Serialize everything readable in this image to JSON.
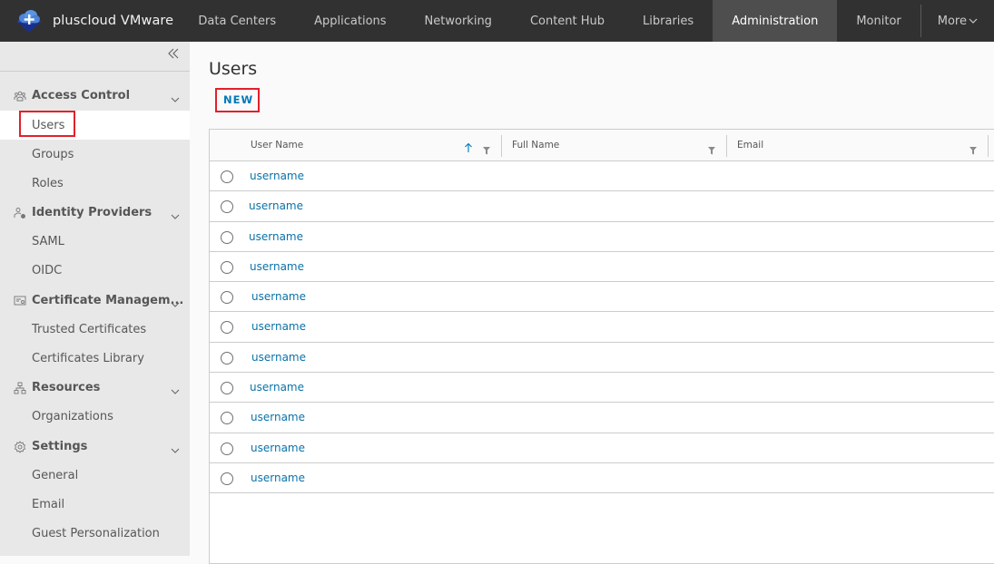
{
  "app": {
    "name": "pluscloud VMware",
    "logo_icon": "cloud-plus-logo"
  },
  "nav": {
    "items": [
      {
        "label": "Data Centers",
        "active": false
      },
      {
        "label": "Applications",
        "active": false
      },
      {
        "label": "Networking",
        "active": false
      },
      {
        "label": "Content Hub",
        "active": false
      },
      {
        "label": "Libraries",
        "active": false
      },
      {
        "label": "Administration",
        "active": true
      },
      {
        "label": "Monitor",
        "active": false
      }
    ],
    "more_label": "More",
    "more_icon": "chevron-down-icon"
  },
  "sidebar": {
    "collapse_icon": "double-chevron-left-icon",
    "sections": [
      {
        "label": "Access Control",
        "icon": "users-group-icon",
        "items": [
          {
            "label": "Users",
            "active": true,
            "highlighted": true
          },
          {
            "label": "Groups",
            "active": false
          },
          {
            "label": "Roles",
            "active": false
          }
        ]
      },
      {
        "label": "Identity Providers",
        "icon": "user-gear-icon",
        "items": [
          {
            "label": "SAML"
          },
          {
            "label": "OIDC"
          }
        ]
      },
      {
        "label": "Certificate Managem...",
        "icon": "certificate-icon",
        "items": [
          {
            "label": "Trusted Certificates"
          },
          {
            "label": "Certificates Library"
          }
        ]
      },
      {
        "label": "Resources",
        "icon": "hierarchy-icon",
        "items": [
          {
            "label": "Organizations"
          }
        ]
      },
      {
        "label": "Settings",
        "icon": "gear-icon",
        "items": [
          {
            "label": "General"
          },
          {
            "label": "Email"
          },
          {
            "label": "Guest Personalization"
          }
        ]
      }
    ]
  },
  "main": {
    "title": "Users",
    "new_button": "NEW",
    "highlight_color": "#e2202b",
    "link_color": "#0a72a8",
    "grid": {
      "columns": [
        {
          "label": "User Name",
          "sorted": "ascending",
          "filter": true
        },
        {
          "label": "Full Name",
          "filter": true
        },
        {
          "label": "Email",
          "filter": true
        }
      ],
      "rows": [
        {
          "user_name": "username",
          "full_name": "",
          "email": ""
        },
        {
          "user_name": "username",
          "full_name": "",
          "email": ""
        },
        {
          "user_name": "username",
          "full_name": "",
          "email": ""
        },
        {
          "user_name": "username",
          "full_name": "",
          "email": ""
        },
        {
          "user_name": "username",
          "full_name": "",
          "email": ""
        },
        {
          "user_name": "username",
          "full_name": "",
          "email": ""
        },
        {
          "user_name": "username",
          "full_name": "",
          "email": ""
        },
        {
          "user_name": "username",
          "full_name": "",
          "email": ""
        },
        {
          "user_name": "username",
          "full_name": "",
          "email": ""
        },
        {
          "user_name": "username",
          "full_name": "",
          "email": ""
        },
        {
          "user_name": "username",
          "full_name": "",
          "email": ""
        }
      ]
    }
  }
}
